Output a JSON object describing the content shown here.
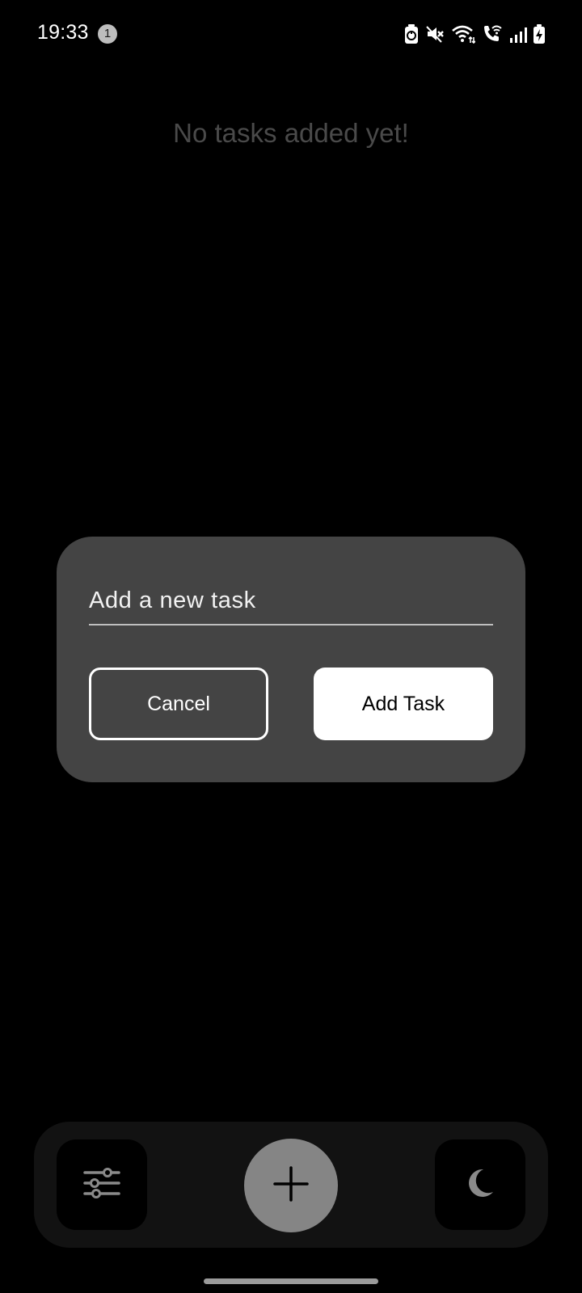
{
  "status_bar": {
    "time": "19:33",
    "notification_count": "1",
    "icons": [
      "battery-saver-icon",
      "mute-icon",
      "wifi-icon",
      "wifi-calling-icon",
      "signal-icon",
      "battery-charging-icon"
    ]
  },
  "main": {
    "empty_message": "No tasks added yet!"
  },
  "dialog": {
    "input_value": "",
    "input_placeholder": "Add a new task",
    "cancel_label": "Cancel",
    "add_label": "Add Task"
  },
  "bottom_nav": {
    "items": [
      {
        "icon": "filter-sliders-icon"
      },
      {
        "icon": "plus-icon"
      },
      {
        "icon": "moon-icon"
      }
    ]
  },
  "colors": {
    "background": "#000000",
    "dialog": "#444444",
    "nav_bar": "#121212",
    "fab": "#858585",
    "empty_text": "#4a4a4a"
  }
}
